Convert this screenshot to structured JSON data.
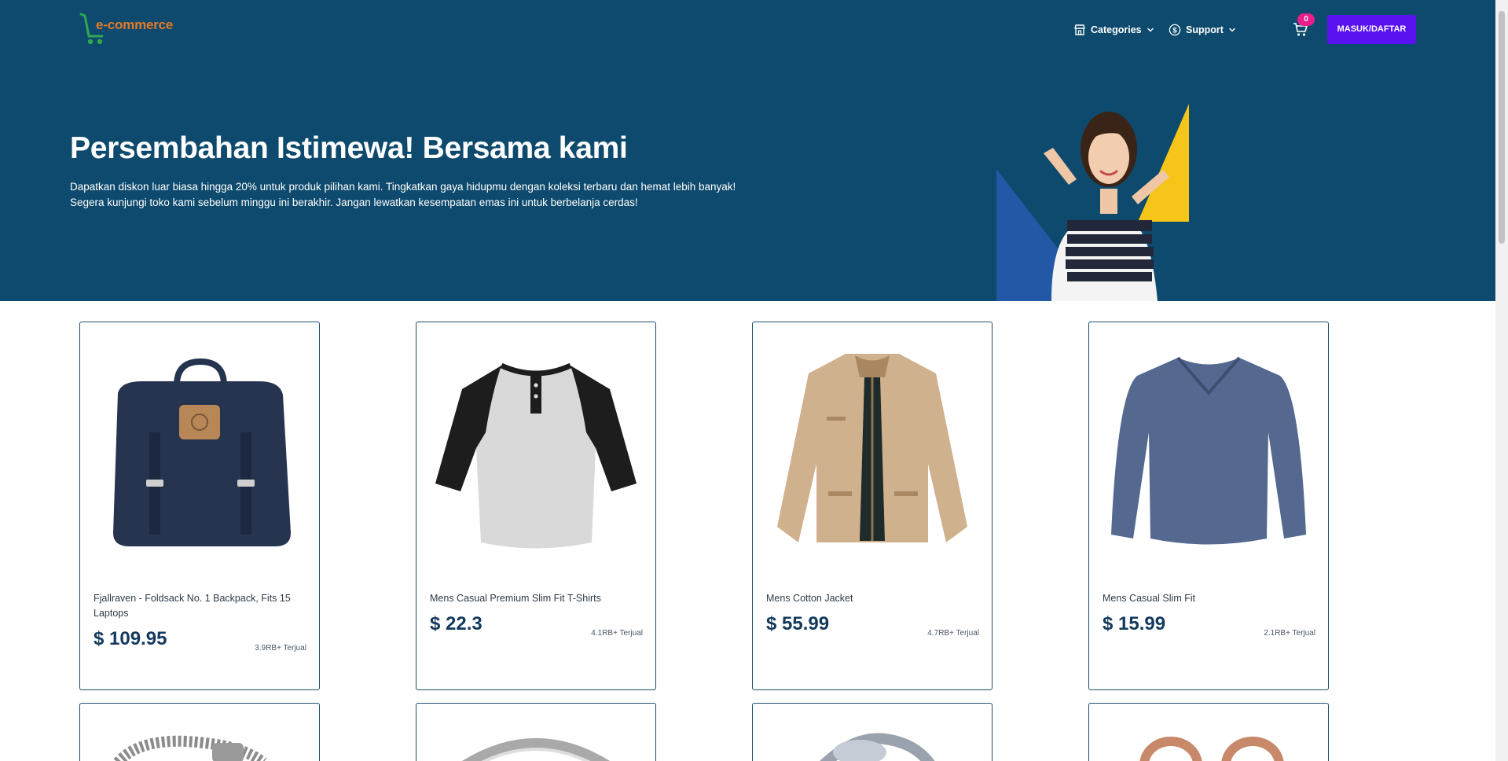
{
  "brand": {
    "logo_text": "e-commerce",
    "icon": "shopping-cart-logo-icon"
  },
  "nav": {
    "categories_label": "Categories",
    "support_label": "Support",
    "cart_count": "0",
    "login_label": "MASUK/DAFTAR"
  },
  "hero": {
    "title": "Persembahan Istimewa! Bersama kami",
    "description": "Dapatkan diskon luar biasa hingga 20% untuk produk pilihan kami. Tingkatkan gaya hidupmu dengan koleksi terbaru dan hemat lebih banyak! Segera kunjungi toko kami sebelum minggu ini berakhir. Jangan lewatkan kesempatan emas ini untuk berbelanja cerdas!"
  },
  "products": [
    {
      "name": "Fjallraven - Foldsack No. 1 Backpack, Fits 15 Laptops",
      "price": "$ 109.95",
      "sold": "3.9RB+ Terjual"
    },
    {
      "name": "Mens Casual Premium Slim Fit T-Shirts",
      "price": "$ 22.3",
      "sold": "4.1RB+ Terjual"
    },
    {
      "name": "Mens Cotton Jacket",
      "price": "$ 55.99",
      "sold": "4.7RB+ Terjual"
    },
    {
      "name": "Mens Casual Slim Fit",
      "price": "$ 15.99",
      "sold": "2.1RB+ Terjual"
    }
  ],
  "colors": {
    "header_bg": "#0e4a6d",
    "login_button": "#5b12f0",
    "badge": "#e91e8c",
    "price": "#13395c",
    "logo_orange": "#e07b2a",
    "logo_green": "#2fa84f"
  }
}
